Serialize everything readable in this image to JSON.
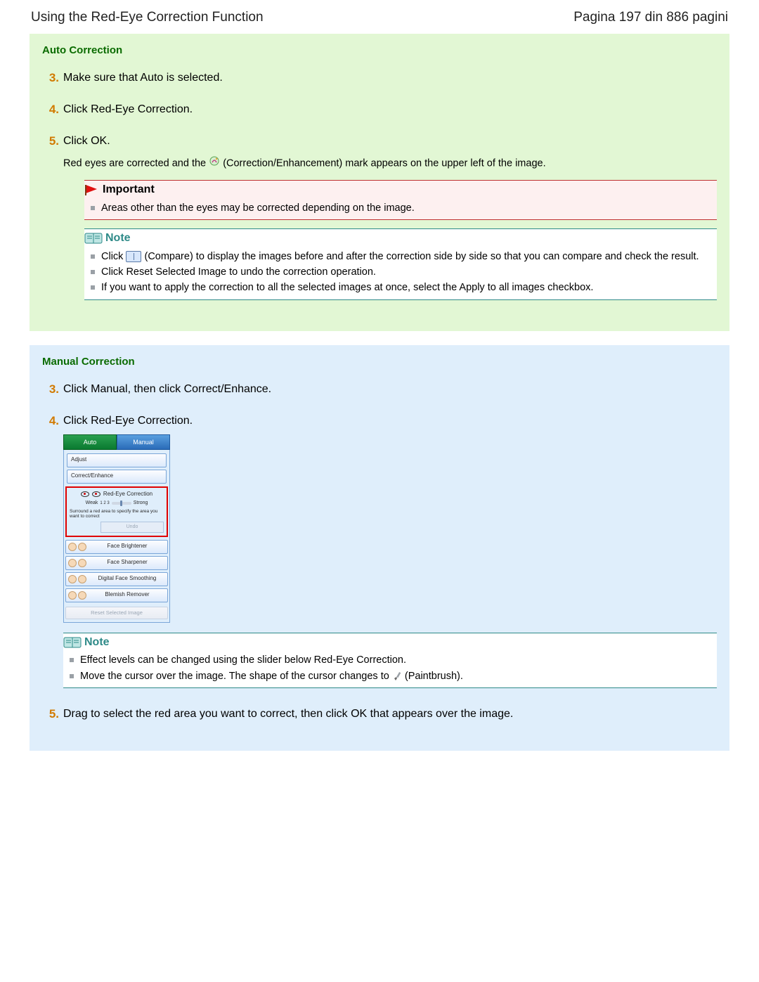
{
  "header": {
    "title": "Using the Red-Eye Correction Function",
    "pager": "Pagina 197 din 886 pagini"
  },
  "auto": {
    "title": "Auto Correction",
    "steps": {
      "s3": {
        "num": "3.",
        "text": "Make sure that Auto is selected."
      },
      "s4": {
        "num": "4.",
        "text": "Click Red-Eye Correction."
      },
      "s5": {
        "num": "5.",
        "text": "Click OK.",
        "sub_before": "Red eyes are corrected and the ",
        "sub_after": " (Correction/Enhancement) mark appears on the upper left of the image."
      }
    },
    "important": {
      "label": "Important",
      "items": [
        "Areas other than the eyes may be corrected depending on the image."
      ]
    },
    "note": {
      "label": "Note",
      "items": {
        "i0_before": "Click ",
        "i0_after": " (Compare) to display the images before and after the correction side by side so that you can compare and check the result.",
        "i1": "Click Reset Selected Image to undo the correction operation.",
        "i2": "If you want to apply the correction to all the selected images at once, select the Apply to all images checkbox."
      }
    }
  },
  "manual": {
    "title": "Manual Correction",
    "steps": {
      "s3": {
        "num": "3.",
        "text": "Click Manual, then click Correct/Enhance."
      },
      "s4": {
        "num": "4.",
        "text": "Click Red-Eye Correction."
      },
      "s5": {
        "num": "5.",
        "text": "Drag to select the red area you want to correct, then click OK that appears over the image."
      }
    },
    "shot": {
      "tab_auto": "Auto",
      "tab_manual": "Manual",
      "adjust": "Adjust",
      "correct_enhance": "Correct/Enhance",
      "redeye": "Red-Eye Correction",
      "weak": "Weak",
      "ticks": "1   2   3",
      "strong": "Strong",
      "desc": "Surround a red area to specify the area you want to correct",
      "undo": "Undo",
      "tools": {
        "t1": "Face Brightener",
        "t2": "Face Sharpener",
        "t3": "Digital Face Smoothing",
        "t4": "Blemish Remover"
      },
      "reset": "Reset Selected Image"
    },
    "note": {
      "label": "Note",
      "items": {
        "i0": "Effect levels can be changed using the slider below Red-Eye Correction.",
        "i1_before": "Move the cursor over the image. The shape of the cursor changes to ",
        "i1_after": " (Paintbrush)."
      }
    }
  }
}
